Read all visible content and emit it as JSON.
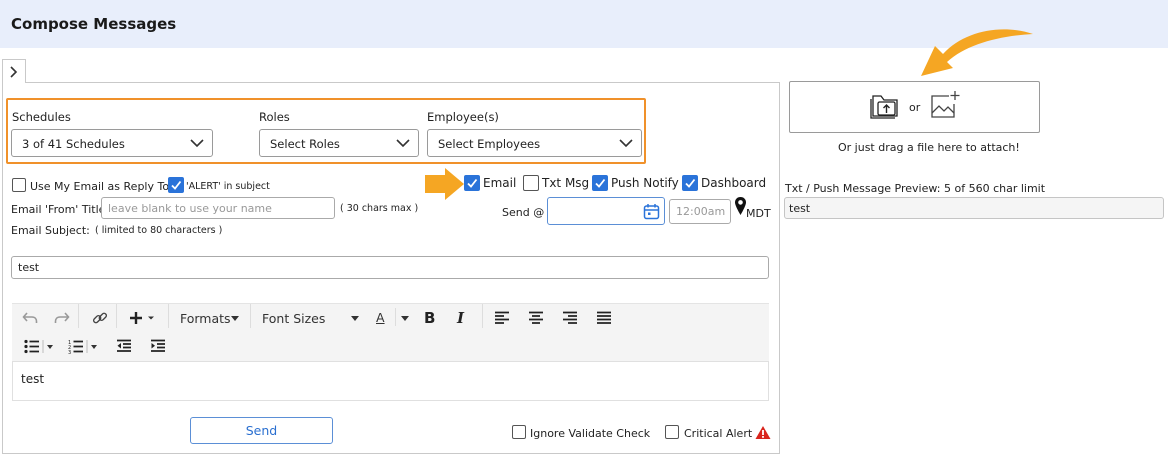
{
  "page": {
    "title": "Compose Messages"
  },
  "filters": {
    "schedules": {
      "label": "Schedules",
      "value": "3 of 41 Schedules"
    },
    "roles": {
      "label": "Roles",
      "value": "Select Roles"
    },
    "employees": {
      "label": "Employee(s)",
      "value": "Select Employees"
    }
  },
  "options": {
    "use_my_email": {
      "label": "Use My Email as Reply To",
      "checked": false
    },
    "alert_in_subject": {
      "label": "'ALERT' in subject",
      "checked": true
    }
  },
  "channels": [
    {
      "label": "Email",
      "checked": true
    },
    {
      "label": "Txt Msg",
      "checked": false
    },
    {
      "label": "Push Notify",
      "checked": true
    },
    {
      "label": "Dashboard",
      "checked": true
    }
  ],
  "email_from": {
    "label": "Email 'From' Title:",
    "placeholder": "leave blank to use your name",
    "hint": "( 30 chars max )"
  },
  "send_at": {
    "label": "Send @",
    "date": "",
    "time_placeholder": "12:00am",
    "timezone": "MDT"
  },
  "email_subject": {
    "label": "Email Subject:",
    "hint": "( limited to 80 characters )",
    "value": "test"
  },
  "toolbar": {
    "formats": "Formats",
    "font_sizes": "Font Sizes",
    "font_color": "A"
  },
  "editor": {
    "content": "test"
  },
  "footer": {
    "send_label": "Send",
    "ignore_validate": {
      "label": "Ignore Validate Check",
      "checked": false
    },
    "critical_alert": {
      "label": "Critical Alert",
      "checked": false
    }
  },
  "attach": {
    "or_text": "or",
    "drag_hint": "Or just drag a file here to attach!"
  },
  "preview": {
    "label": "Txt / Push Message Preview: 5 of 560 char limit",
    "value": "test"
  },
  "colors": {
    "accent": "#2a73d9",
    "highlight": "#f0912a",
    "header_bg": "#e8eefb",
    "alert": "#d9251d"
  }
}
